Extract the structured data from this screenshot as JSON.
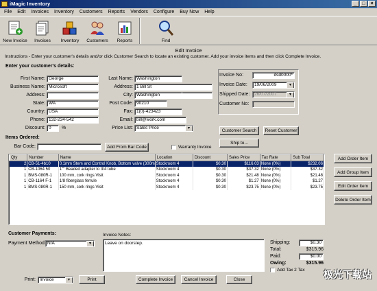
{
  "window": {
    "title": "iMagic Inventory",
    "min": "_",
    "max": "□",
    "close": "×"
  },
  "menu": [
    "File",
    "Edit",
    "Invoices",
    "Inventory",
    "Customers",
    "Reports",
    "Vendors",
    "Configure",
    "Buy Now",
    "Help"
  ],
  "toolbar": {
    "new_invoice": "New Invoice",
    "invoices": "Invoices",
    "inventory": "Inventory",
    "customers": "Customers",
    "reports": "Reports",
    "find": "Find"
  },
  "page": {
    "title": "Edit Invoice",
    "instructions": "Instructions - Enter your customer's details and/or click Customer Search to locate an existing customer. Add your invoice items and then click Complete Invoice."
  },
  "customer": {
    "section": "Enter your customer's details:",
    "first_name_label": "First Name:",
    "first_name": "George",
    "last_name_label": "Last Name:",
    "last_name": "Washington",
    "business_label": "Business Name:",
    "business": "Microsoft",
    "address_label": "Address:",
    "address_1": "1 Bill St",
    "address2_label": "Address:",
    "address_2": "",
    "city_label": "City:",
    "city": "Washington",
    "state_label": "State:",
    "state": "WA",
    "postcode_label": "Post Code:",
    "postcode": "90210",
    "country_label": "Country:",
    "country": "USA",
    "fax_label": "Fax:",
    "fax": "1(0)-423423",
    "phone_label": "Phone:",
    "phone": "132-234-542",
    "email_label": "Email:",
    "email": "bill@work.com",
    "discount_label": "Discount:",
    "discount": "0",
    "discount_unit": "%",
    "pricelist_label": "Price List:",
    "pricelist": "Sales Price"
  },
  "invoice": {
    "no_label": "Invoice No:",
    "no": "dsd0000*",
    "date_label": "Invoice Date:",
    "date": "19/06/2009",
    "shipped_label": "Shipped Date:",
    "shipped": "26/07/2007",
    "custno_label": "Customer No:",
    "custno": ""
  },
  "buttons": {
    "customer_search": "Customer Search",
    "reset_customer": "Reset Customer",
    "ship_to": "Ship to...",
    "add_from_barcode": "Add From Bar Code",
    "add_order_item": "Add Order Item",
    "add_group_item": "Add Group Item",
    "edit_order_item": "Edit Order Item",
    "delete_order_item": "Delete Order Item",
    "print": "Print",
    "complete_invoice": "Complete Invoice",
    "cancel_invoice": "Cancel Invoice",
    "close": "Close"
  },
  "items": {
    "section": "Items Ordered:",
    "barcode_label": "Bar Code:",
    "warranty_label": "Warranty Invoice",
    "columns": [
      "Qty",
      "Number",
      "Name",
      "Location",
      "Discount",
      "Sales Price",
      "Tax Rate",
      "Sub Total"
    ],
    "rows": [
      [
        "2",
        "CB-51-4b10",
        "0.1mm Stem and Control Knob, Bottom valve (300mm - 1 litre)",
        "Stockroom 4",
        "$0.30",
        "$116.03",
        "None (0%)",
        "$232.06"
      ],
      [
        "1",
        "CB-1064 50",
        "1\"\" Beaded adapter to 3/4 tube",
        "Stockroom 4",
        "$0.30",
        "$37.32",
        "None (0%)",
        "$37.32"
      ],
      [
        "1",
        "BMS-080R-1",
        "100 mm, cork rings Visit",
        "Stockroom 4",
        "$0.30",
        "$21.48",
        "None (0%)",
        "$21.48"
      ],
      [
        "1",
        "CB-1164 F-1",
        "1/8 fiberglass ferrule",
        "Stockroom 4",
        "$0.30",
        "$1.27",
        "None (0%)",
        "$1.27"
      ],
      [
        "1",
        "BMS-080R-1",
        "150 mm, cork rings Visit",
        "Stockroom 4",
        "$0.30",
        "$23.75",
        "None (0%)",
        "$23.75"
      ]
    ]
  },
  "payments": {
    "section": "Customer Payments:",
    "method_label": "Payment Method:",
    "method": "N/A",
    "notes_label": "Invoice Notes:",
    "notes": "Leave on doorstep.",
    "shipping_label": "Shipping:",
    "shipping": "$0.30",
    "total_label": "Total:",
    "total": "$315.96",
    "paid_label": "Paid:",
    "paid": "$0.00",
    "owing_label": "Owing:",
    "owing": "$315.96",
    "addtax_label": "Add Tax 2 Tax"
  },
  "print": {
    "label": "Print:",
    "value": "Invoice"
  },
  "watermark": "极光下载站"
}
